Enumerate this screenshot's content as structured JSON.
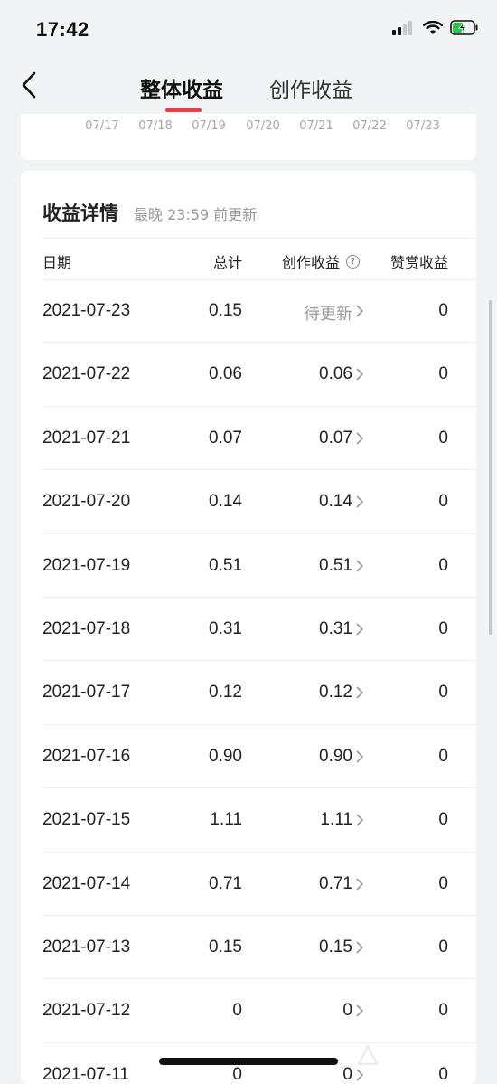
{
  "status_bar": {
    "time": "17:42",
    "icons": [
      "cellular-signal-icon",
      "wifi-icon",
      "battery-charging-icon"
    ]
  },
  "nav": {
    "back_icon": "chevron-left-icon",
    "tabs": [
      {
        "label": "整体收益",
        "active": true
      },
      {
        "label": "创作收益",
        "active": false
      }
    ],
    "accent_color": "#e5404d"
  },
  "chart": {
    "x_labels": [
      "07/17",
      "07/18",
      "07/19",
      "07/20",
      "07/21",
      "07/22",
      "07/23"
    ]
  },
  "details": {
    "title": "收益详情",
    "subtitle": "最晚 23:59 前更新",
    "columns": {
      "date": "日期",
      "total": "总计",
      "creation": "创作收益",
      "creation_help_icon": "question-circle-icon",
      "reward": "赞赏收益"
    },
    "rows": [
      {
        "date": "2021-07-23",
        "total": "0.15",
        "creation": "待更新",
        "reward": "0"
      },
      {
        "date": "2021-07-22",
        "total": "0.06",
        "creation": "0.06",
        "reward": "0"
      },
      {
        "date": "2021-07-21",
        "total": "0.07",
        "creation": "0.07",
        "reward": "0"
      },
      {
        "date": "2021-07-20",
        "total": "0.14",
        "creation": "0.14",
        "reward": "0"
      },
      {
        "date": "2021-07-19",
        "total": "0.51",
        "creation": "0.51",
        "reward": "0"
      },
      {
        "date": "2021-07-18",
        "total": "0.31",
        "creation": "0.31",
        "reward": "0"
      },
      {
        "date": "2021-07-17",
        "total": "0.12",
        "creation": "0.12",
        "reward": "0"
      },
      {
        "date": "2021-07-16",
        "total": "0.90",
        "creation": "0.90",
        "reward": "0"
      },
      {
        "date": "2021-07-15",
        "total": "1.11",
        "creation": "1.11",
        "reward": "0"
      },
      {
        "date": "2021-07-14",
        "total": "0.71",
        "creation": "0.71",
        "reward": "0"
      },
      {
        "date": "2021-07-13",
        "total": "0.15",
        "creation": "0.15",
        "reward": "0"
      },
      {
        "date": "2021-07-12",
        "total": "0",
        "creation": "0",
        "reward": "0"
      },
      {
        "date": "2021-07-11",
        "total": "0",
        "creation": "0",
        "reward": "0"
      }
    ]
  }
}
